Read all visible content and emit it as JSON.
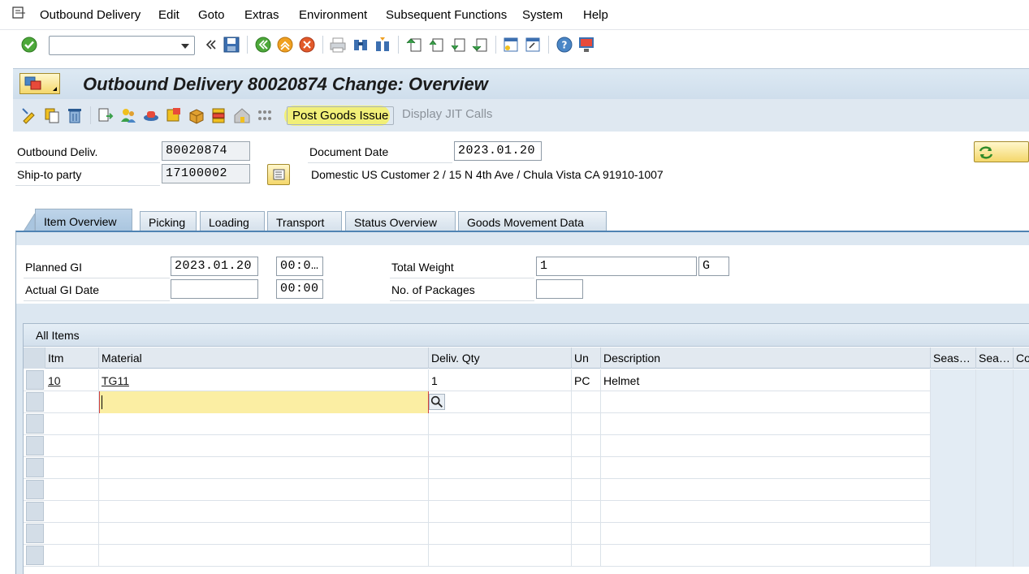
{
  "menu": {
    "items": [
      "Outbound Delivery",
      "Edit",
      "Goto",
      "Extras",
      "Environment",
      "Subsequent Functions",
      "System",
      "Help"
    ]
  },
  "title": "Outbound Delivery 80020874 Change: Overview",
  "app_toolbar": {
    "post_goods_issue": "Post Goods Issue",
    "display_jit_calls": "Display JIT Calls"
  },
  "header": {
    "outbound_deliv_label": "Outbound Deliv.",
    "outbound_deliv_value": "80020874",
    "ship_to_label": "Ship-to party",
    "ship_to_value": "17100002",
    "document_date_label": "Document Date",
    "document_date_value": "2023.01.20",
    "ship_to_address": "Domestic US Customer 2 / 15 N 4th Ave / Chula Vista CA 91910-1007"
  },
  "tabs": [
    "Item Overview",
    "Picking",
    "Loading",
    "Transport",
    "Status Overview",
    "Goods Movement Data"
  ],
  "item_overview": {
    "planned_gi_label": "Planned GI",
    "planned_gi_date": "2023.01.20",
    "planned_gi_time": "00:0…",
    "actual_gi_label": "Actual GI Date",
    "actual_gi_date": "",
    "actual_gi_time": "00:00",
    "total_weight_label": "Total Weight",
    "total_weight_value": "1",
    "total_weight_unit": "G",
    "packages_label": "No. of Packages",
    "packages_value": ""
  },
  "table": {
    "title": "All Items",
    "columns": [
      "Itm",
      "Material",
      "Deliv. Qty",
      "Un",
      "Description",
      "Seas…",
      "Sea…",
      "Co"
    ],
    "rows": [
      {
        "itm": "10",
        "material": "TG11",
        "qty": "1",
        "un": "PC",
        "description": "Helmet"
      }
    ]
  },
  "colors": {
    "title_bg": "#d4e2ef",
    "tab_active": "#b3cce4",
    "highlight": "#f3f06a",
    "input_focus": "#fbeea3"
  }
}
